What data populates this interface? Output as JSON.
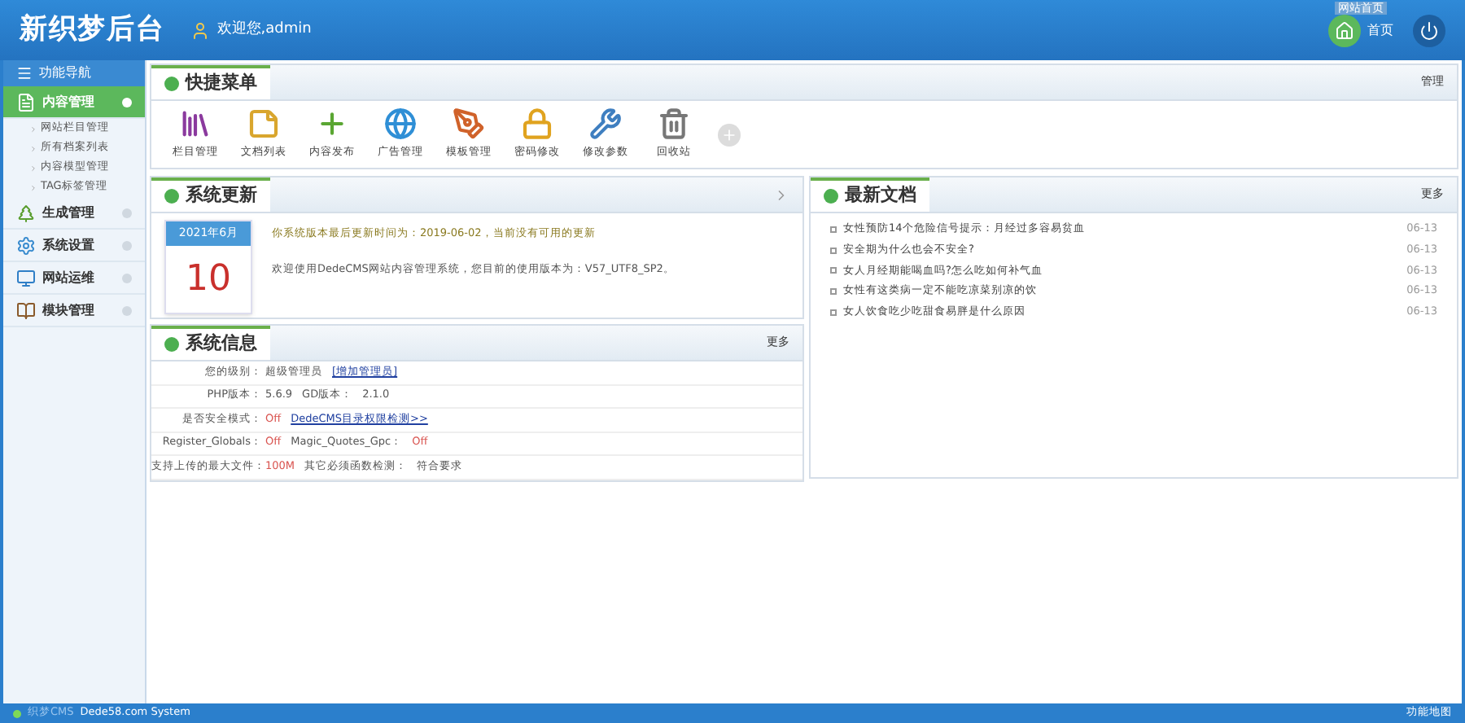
{
  "header": {
    "logo": "新织梦后台",
    "welcome": "欢迎您,admin",
    "home_tooltip": "网站首页",
    "home_label": "首页"
  },
  "sidebar": {
    "title": "功能导航",
    "items": [
      {
        "kind": "content",
        "label": "内容管理",
        "expanded": true,
        "selected": true,
        "children": [
          {
            "label": "网站栏目管理"
          },
          {
            "label": "所有档案列表"
          },
          {
            "label": "内容模型管理"
          },
          {
            "label": "TAG标签管理"
          }
        ]
      },
      {
        "kind": "tree",
        "label": "生成管理",
        "expanded": false,
        "selected": false
      },
      {
        "kind": "gear",
        "label": "系统设置",
        "expanded": false,
        "selected": false
      },
      {
        "kind": "monitor",
        "label": "网站运维",
        "expanded": false,
        "selected": false
      },
      {
        "kind": "book",
        "label": "模块管理",
        "expanded": false,
        "selected": false
      }
    ]
  },
  "quick_menu": {
    "title": "快捷菜单",
    "action": "管理",
    "items": [
      {
        "kind": "books",
        "label": "栏目管理"
      },
      {
        "kind": "note",
        "label": "文档列表"
      },
      {
        "kind": "plus",
        "label": "内容发布"
      },
      {
        "kind": "globe",
        "label": "广告管理"
      },
      {
        "kind": "tools",
        "label": "模板管理"
      },
      {
        "kind": "lock",
        "label": "密码修改"
      },
      {
        "kind": "wrench",
        "label": "修改参数"
      },
      {
        "kind": "trash",
        "label": "回收站"
      }
    ]
  },
  "system_update": {
    "title": "系统更新",
    "calendar_month": "2021年6月",
    "calendar_day": "10",
    "notice": "你系统版本最后更新时间为：2019-06-02，当前没有可用的更新",
    "welcome": "欢迎使用DedeCMS网站内容管理系统，您目前的使用版本为：V57_UTF8_SP2。"
  },
  "system_info": {
    "title": "系统信息",
    "more": "更多",
    "rows": [
      {
        "label": "您的级别：",
        "parts": [
          {
            "kind": "text",
            "text": "超级管理员"
          },
          {
            "kind": "link",
            "text": "[增加管理员]"
          }
        ]
      },
      {
        "label": "PHP版本：",
        "parts": [
          {
            "kind": "text",
            "text": "5.6.9"
          },
          {
            "kind": "text",
            "text": "GD版本："
          },
          {
            "kind": "text",
            "text": "2.1.0"
          }
        ]
      },
      {
        "label": "是否安全模式：",
        "parts": [
          {
            "kind": "off",
            "text": "Off"
          },
          {
            "kind": "link",
            "text": "DedeCMS目录权限检测>>"
          }
        ]
      },
      {
        "label": "Register_Globals：",
        "parts": [
          {
            "kind": "off",
            "text": "Off"
          },
          {
            "kind": "text",
            "text": "Magic_Quotes_Gpc："
          },
          {
            "kind": "off",
            "text": "Off"
          }
        ]
      },
      {
        "label": "支持上传的最大文件：",
        "parts": [
          {
            "kind": "off",
            "text": "100M"
          },
          {
            "kind": "text",
            "text": "其它必须函数检测："
          },
          {
            "kind": "text",
            "text": "符合要求"
          }
        ]
      }
    ]
  },
  "latest_docs": {
    "title": "最新文档",
    "more": "更多",
    "items": [
      {
        "title": "女性预防14个危险信号提示：月经过多容易贫血",
        "date": "06-13"
      },
      {
        "title": "安全期为什么也会不安全?",
        "date": "06-13"
      },
      {
        "title": "女人月经期能喝血吗?怎么吃如何补气血",
        "date": "06-13"
      },
      {
        "title": "女性有这类病一定不能吃凉菜别凉的饮",
        "date": "06-13"
      },
      {
        "title": "女人饮食吃少吃甜食易胖是什么原因",
        "date": "06-13"
      }
    ]
  },
  "status_bar": {
    "brand": "织梦CMS",
    "system": "Dede58.com System",
    "map": "功能地图"
  }
}
